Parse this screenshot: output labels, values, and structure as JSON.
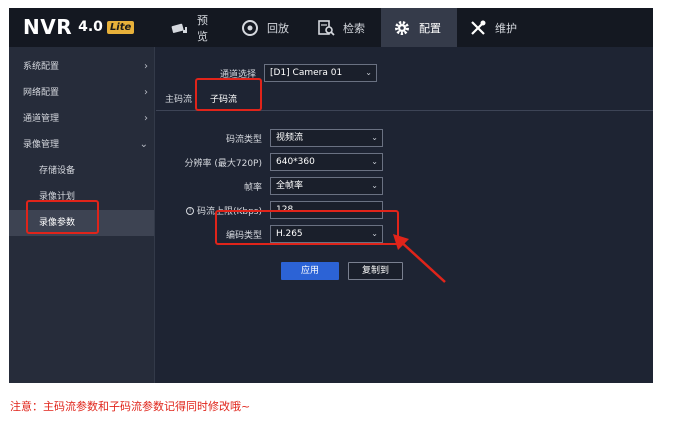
{
  "brand": {
    "name": "NVR",
    "version": "4.0",
    "edition": "Lite"
  },
  "nav": [
    {
      "id": "preview",
      "label": "预览",
      "icon": "camera-icon"
    },
    {
      "id": "playback",
      "label": "回放",
      "icon": "playback-icon"
    },
    {
      "id": "search",
      "label": "检索",
      "icon": "search-document-icon"
    },
    {
      "id": "config",
      "label": "配置",
      "icon": "gear-icon",
      "active": true
    },
    {
      "id": "maintenance",
      "label": "维护",
      "icon": "tools-icon"
    }
  ],
  "sidebar": {
    "items": [
      {
        "label": "系统配置",
        "expanded": false
      },
      {
        "label": "网络配置",
        "expanded": false
      },
      {
        "label": "通道管理",
        "expanded": false
      },
      {
        "label": "录像管理",
        "expanded": true
      }
    ],
    "subitems": [
      {
        "label": "存储设备"
      },
      {
        "label": "录像计划"
      },
      {
        "label": "录像参数",
        "active": true
      }
    ]
  },
  "channel": {
    "label": "通道选择",
    "value": "[D1] Camera 01"
  },
  "tabs": [
    {
      "label": "主码流"
    },
    {
      "label": "子码流",
      "active": true
    }
  ],
  "form": {
    "stream_type": {
      "label": "码流类型",
      "value": "视频流"
    },
    "resolution": {
      "label": "分辨率 (最大720P)",
      "value": "640*360"
    },
    "frame_rate": {
      "label": "帧率",
      "value": "全帧率"
    },
    "bitrate": {
      "label": "码流上限(Kbps)",
      "value": "128"
    },
    "encoding": {
      "label": "编码类型",
      "value": "H.265"
    }
  },
  "buttons": {
    "apply": "应用",
    "copy_to": "复制到"
  },
  "note": "注意：主码流参数和子码流参数记得同时修改哦~",
  "colors": {
    "accent": "#2c63d6",
    "annotation": "#e0241a",
    "background": "#1e2433"
  }
}
